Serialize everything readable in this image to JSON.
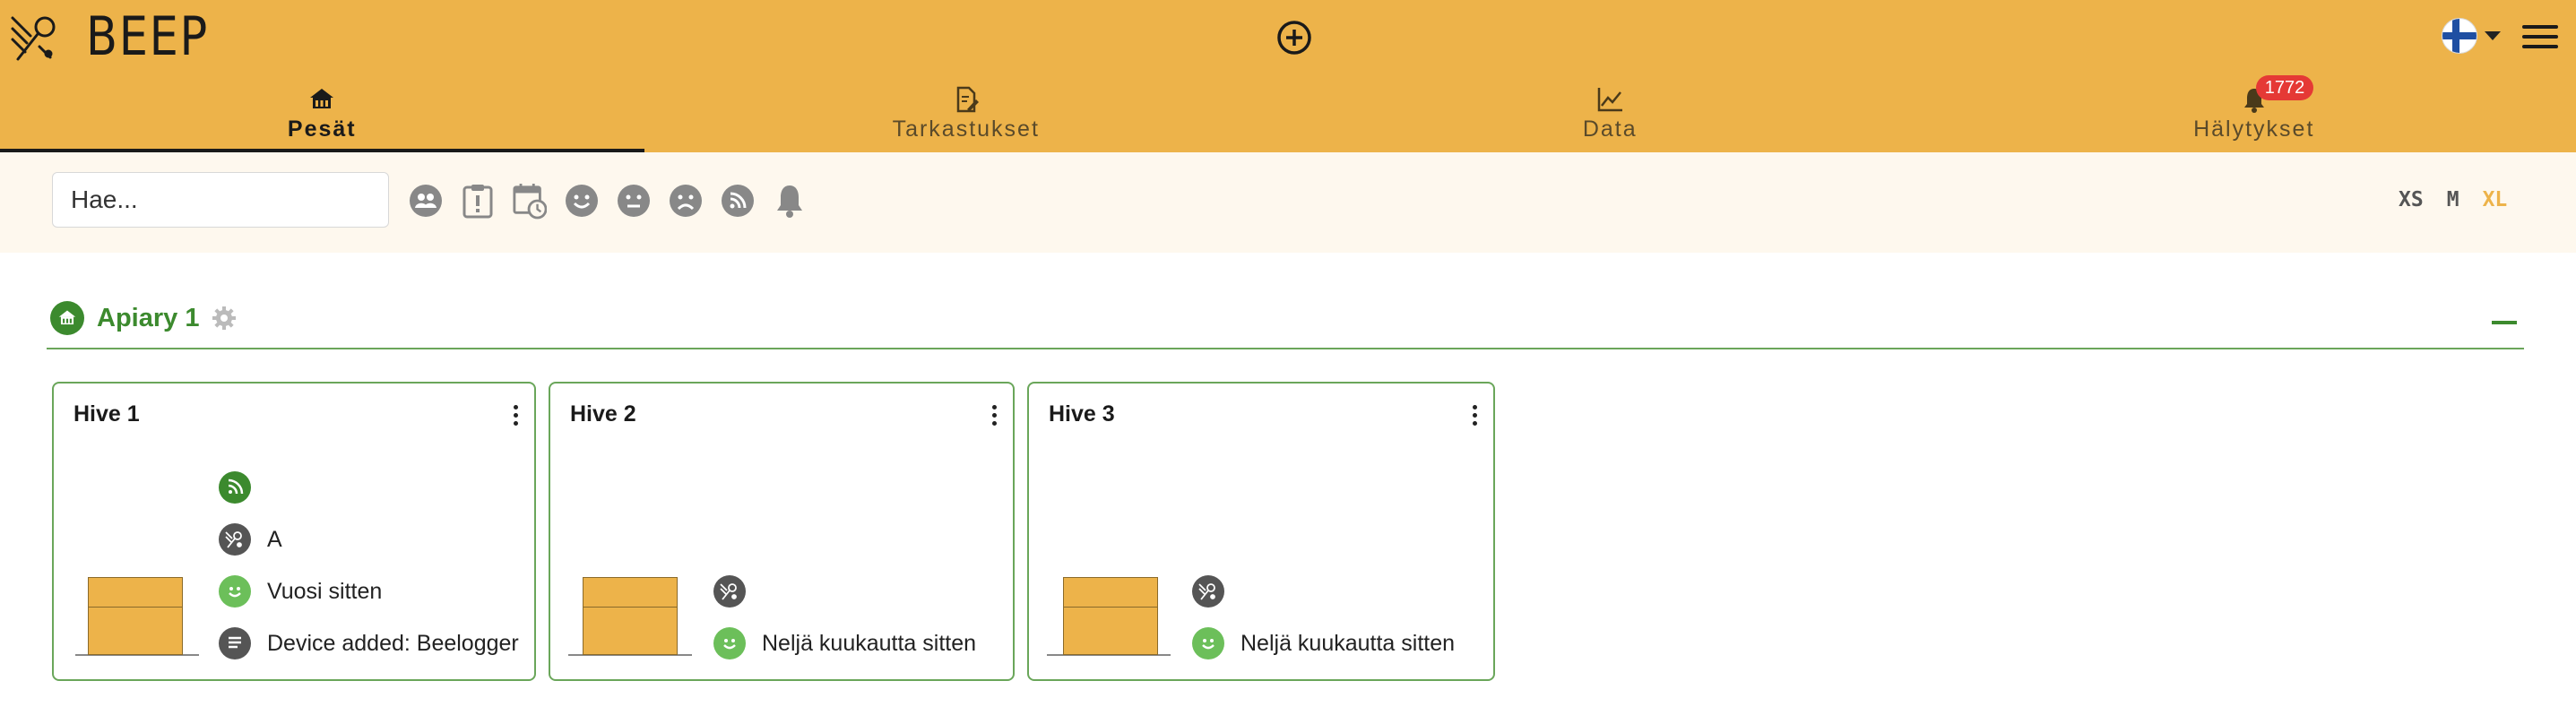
{
  "app": {
    "brand": "BEEP"
  },
  "tabs": [
    {
      "label": "Pesät",
      "icon": "home-icon",
      "active": true
    },
    {
      "label": "Tarkastukset",
      "icon": "checklist-icon",
      "active": false
    },
    {
      "label": "Data",
      "icon": "line-chart-icon",
      "active": false
    },
    {
      "label": "Hälytykset",
      "icon": "bell-icon",
      "active": false,
      "badge": "1772"
    }
  ],
  "search": {
    "placeholder": "Hae..."
  },
  "filters": [
    "group-icon",
    "clipboard-alert-icon",
    "calendar-clock-icon",
    "smile-icon",
    "neutral-face-icon",
    "sad-face-icon",
    "rss-icon",
    "bell-icon"
  ],
  "sizes": [
    {
      "label": "XS",
      "active": false
    },
    {
      "label": "M",
      "active": false
    },
    {
      "label": "XL",
      "active": true
    }
  ],
  "apiary": {
    "name": "Apiary 1"
  },
  "hives": [
    {
      "name": "Hive 1",
      "rows": [
        {
          "icon": "rss-icon",
          "text": ""
        },
        {
          "icon": "queen-icon",
          "text": "A"
        },
        {
          "icon": "smile-icon",
          "text": "Vuosi sitten"
        },
        {
          "icon": "notes-icon",
          "text": "Device added: Beelogger"
        }
      ]
    },
    {
      "name": "Hive 2",
      "rows": [
        {
          "icon": "queen-icon",
          "text": ""
        },
        {
          "icon": "smile-icon",
          "text": "Neljä kuukautta sitten"
        }
      ]
    },
    {
      "name": "Hive 3",
      "rows": [
        {
          "icon": "queen-icon",
          "text": ""
        },
        {
          "icon": "smile-icon",
          "text": "Neljä kuukautta sitten"
        }
      ]
    }
  ],
  "colors": {
    "brand": "#EDB34A",
    "green": "#3c8a2e",
    "filterbg": "#FEF8EE"
  }
}
